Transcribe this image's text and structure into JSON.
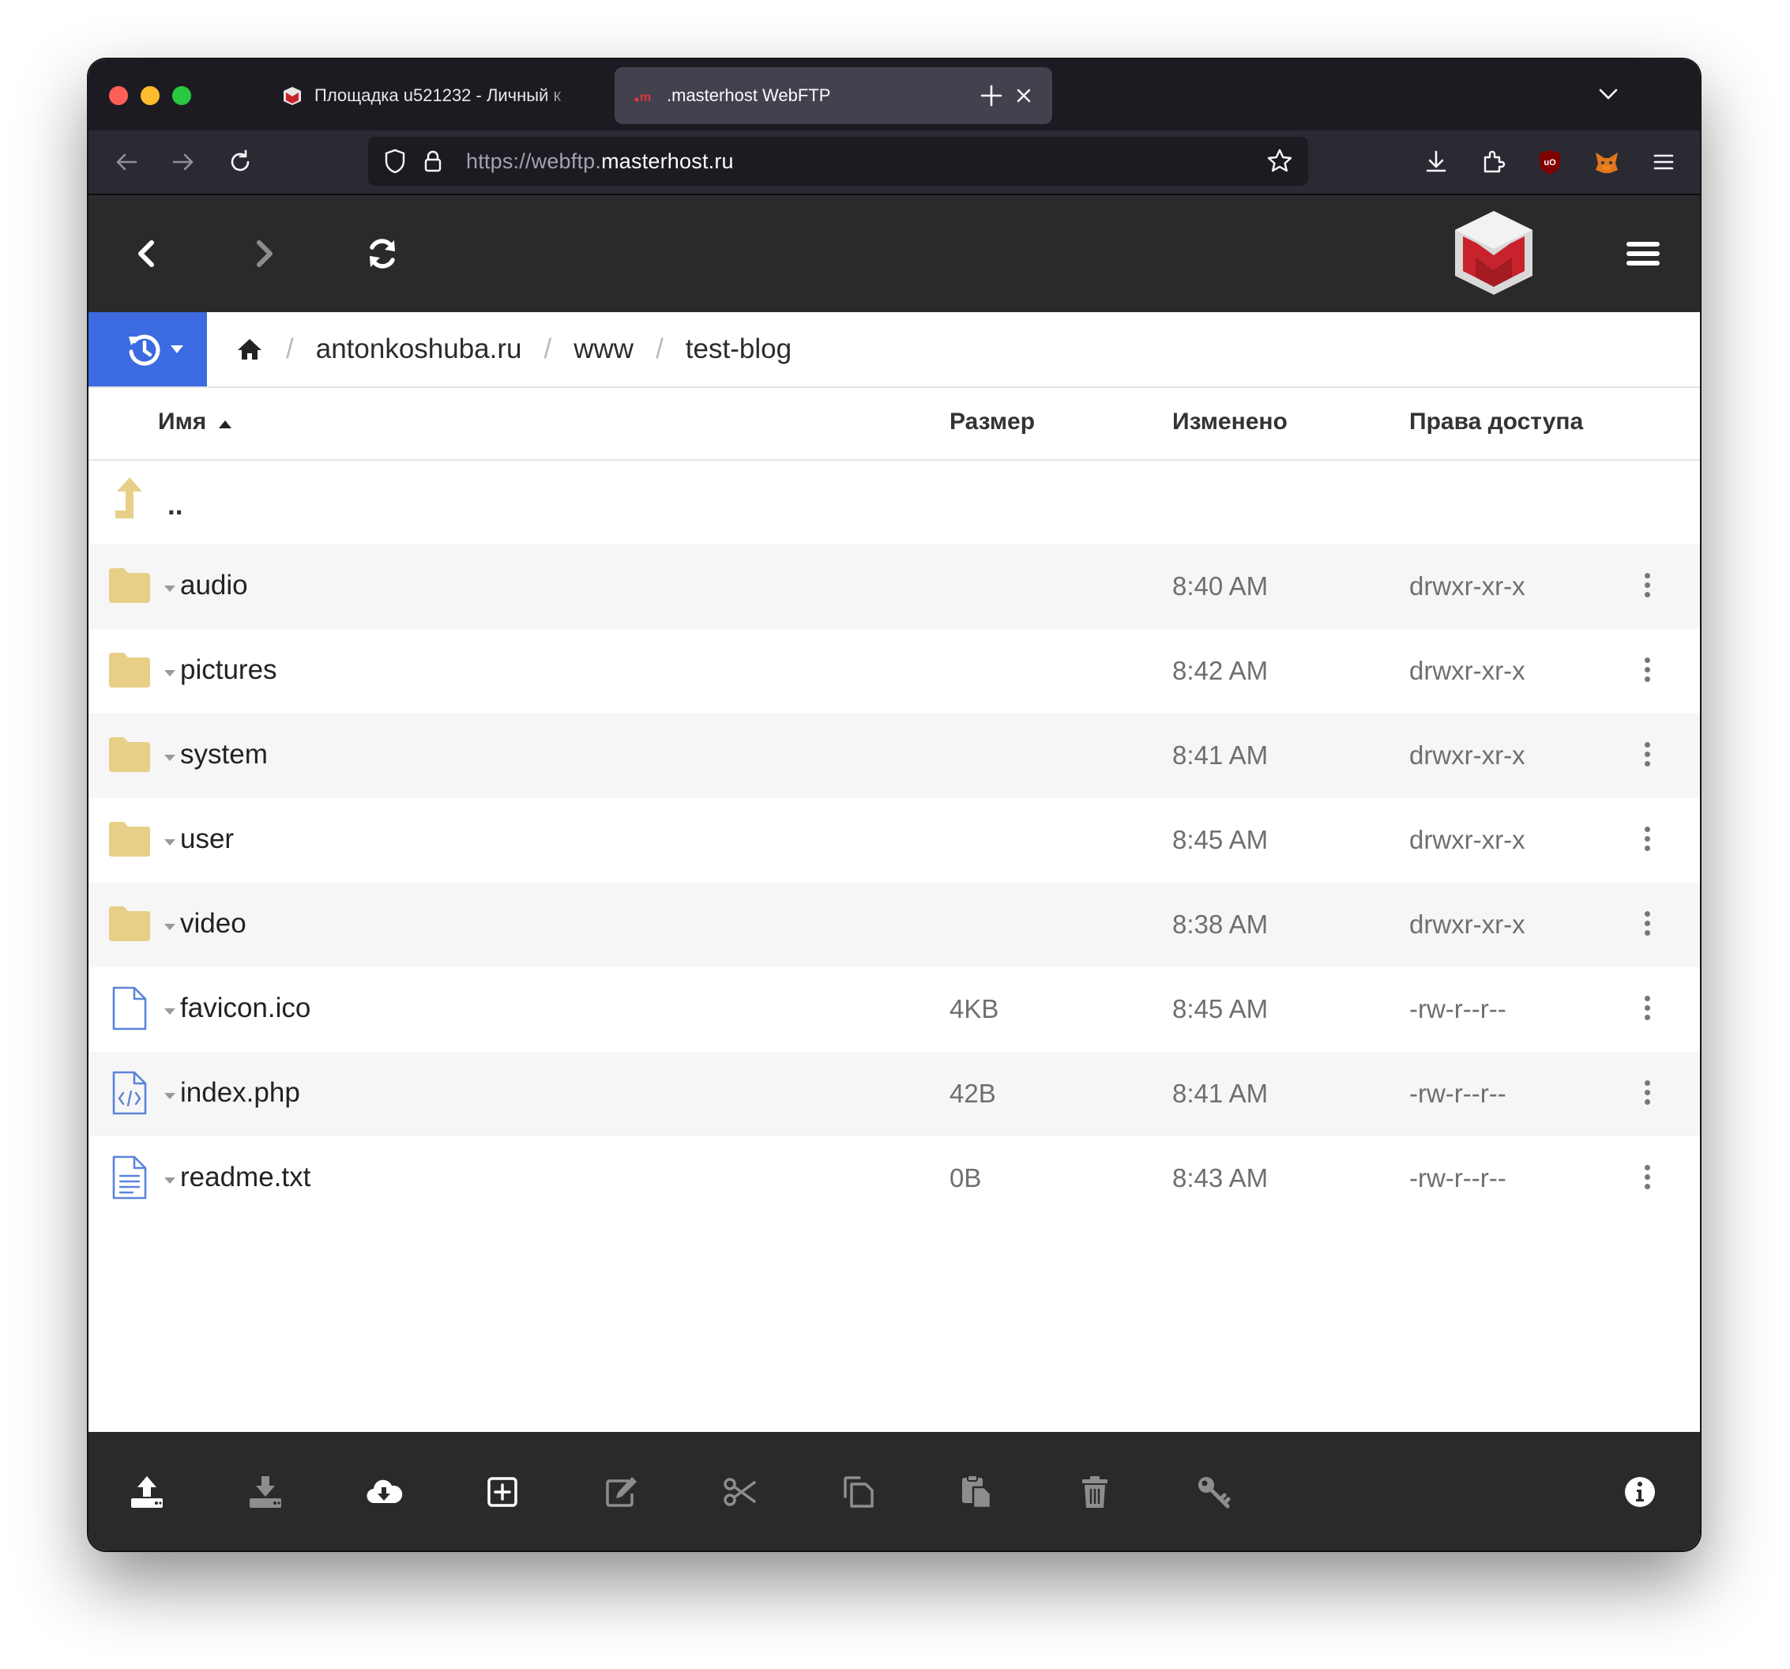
{
  "browser": {
    "tabs": [
      {
        "title": "Площадка u521232 - Личный к",
        "active": false
      },
      {
        "title": ".masterhost WebFTP",
        "active": true
      }
    ],
    "url_prefix": "https://webftp.",
    "url_host": "masterhost.ru"
  },
  "breadcrumb": [
    "antonkoshuba.ru",
    "www",
    "test-blog"
  ],
  "table": {
    "headers": {
      "name": "Имя",
      "size": "Размер",
      "modified": "Изменено",
      "permissions": "Права доступа"
    },
    "sort": {
      "column": "name",
      "direction": "ascending"
    },
    "parent_label": "..",
    "rows": [
      {
        "name": "audio",
        "type": "folder",
        "size": "",
        "modified": "8:40 AM",
        "permissions": "drwxr-xr-x"
      },
      {
        "name": "pictures",
        "type": "folder",
        "size": "",
        "modified": "8:42 AM",
        "permissions": "drwxr-xr-x"
      },
      {
        "name": "system",
        "type": "folder",
        "size": "",
        "modified": "8:41 AM",
        "permissions": "drwxr-xr-x"
      },
      {
        "name": "user",
        "type": "folder",
        "size": "",
        "modified": "8:45 AM",
        "permissions": "drwxr-xr-x"
      },
      {
        "name": "video",
        "type": "folder",
        "size": "",
        "modified": "8:38 AM",
        "permissions": "drwxr-xr-x"
      },
      {
        "name": "favicon.ico",
        "type": "file",
        "size": "4KB",
        "modified": "8:45 AM",
        "permissions": "-rw-r--r--"
      },
      {
        "name": "index.php",
        "type": "code",
        "size": "42B",
        "modified": "8:41 AM",
        "permissions": "-rw-r--r--"
      },
      {
        "name": "readme.txt",
        "type": "text",
        "size": "0B",
        "modified": "8:43 AM",
        "permissions": "-rw-r--r--"
      }
    ]
  },
  "colors": {
    "accent": "#3c6ae0",
    "folder": "#e7cf88",
    "file_icon": "#5b84d9",
    "toolbar_bg": "#2a2a2c",
    "brand_red": "#c8232c"
  },
  "icons": {
    "toolbar_top": [
      "back-icon",
      "forward-icon",
      "refresh-icon",
      "masterhost-logo",
      "menu-icon"
    ],
    "toolbar_bottom": [
      "upload-icon",
      "download-icon",
      "cloud-download-icon",
      "new-item-icon",
      "rename-icon",
      "cut-icon",
      "copy-icon",
      "paste-icon",
      "delete-icon",
      "permissions-key-icon",
      "info-icon"
    ]
  }
}
